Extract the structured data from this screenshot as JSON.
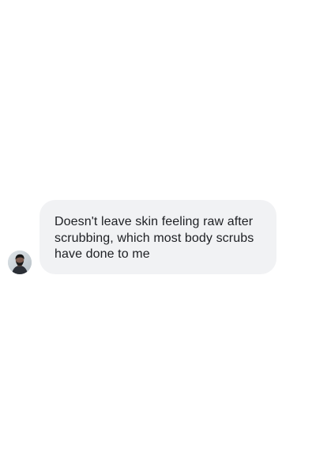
{
  "message": {
    "text": "Doesn't leave skin feeling raw after scrubbing, which most body scrubs have done to me",
    "avatar_icon": "user-avatar-icon"
  },
  "colors": {
    "page_background": "#ffffff",
    "bubble_background": "#f1f2f4",
    "text": "#1d1f23"
  }
}
